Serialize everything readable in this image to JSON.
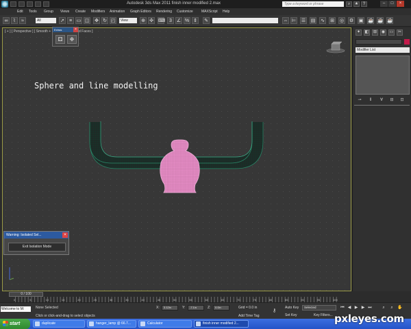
{
  "window": {
    "title": "Autodesk 3ds Max  2011     finish inner modified 2.max",
    "search_placeholder": "Type a keyword or phrase"
  },
  "menu": [
    "Edit",
    "Tools",
    "Group",
    "Views",
    "Create",
    "Modifiers",
    "Animation",
    "Graph Editors",
    "Rendering",
    "Customize",
    "MAXScript",
    "Help"
  ],
  "toolbar": {
    "selection_filter": "All",
    "reference_coord": "View"
  },
  "viewport": {
    "label": "[ + ] [ Perspective ] [ Smooth + Highlights + Edged Faces ]",
    "overlay_text": "Sphere and line modelling"
  },
  "extras_toolbar": {
    "title": "Extras"
  },
  "warning_dialog": {
    "title": "Warning: Isolated Sel...",
    "exit_button": "Exit Isolation Mode"
  },
  "command_panel": {
    "modifier_list": "Modifier List",
    "object_color": "#c21a4a"
  },
  "timeline": {
    "slider": "0 / 100",
    "ticks": [
      "0",
      "5",
      "10",
      "15",
      "20",
      "25",
      "30",
      "35",
      "40",
      "45",
      "50",
      "55",
      "60",
      "65",
      "70",
      "75",
      "80",
      "85",
      "90",
      "95",
      "100"
    ]
  },
  "statusbar": {
    "maxscript": "Welcome to M:",
    "selection": "None Selected",
    "prompt": "Click or click-and-drag to select objects",
    "x_label": "X:",
    "x_value": "3.12in",
    "y_label": "Y:",
    "y_value": "-7.1in",
    "z_label": "Z:",
    "z_value": "0.0in",
    "grid": "Grid = 0.0 in",
    "add_time_tag": "Add Time Tag",
    "auto_key": "Auto Key",
    "set_key": "Set Key",
    "key_mode": "Selected",
    "key_filters": "Key Filters..."
  },
  "taskbar": {
    "start": "start",
    "tasks": [
      "duplicate",
      "hanger_lamp @ 66.7...",
      "Calculator",
      "finish inner modified 2..."
    ]
  },
  "watermark": "pxleyes.com"
}
